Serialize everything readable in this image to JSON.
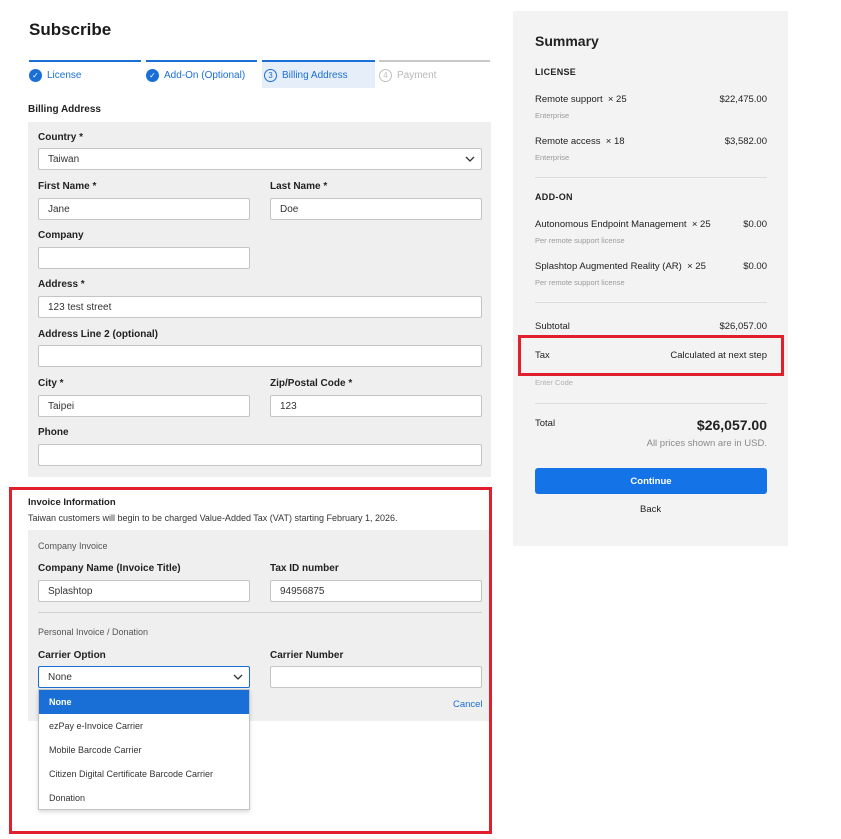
{
  "page": {
    "title": "Subscribe"
  },
  "steps": [
    {
      "label": "License",
      "icon": "check-icon"
    },
    {
      "label": "Add-On (Optional)",
      "icon": "check-icon"
    },
    {
      "number": "3",
      "label": "Billing Address"
    },
    {
      "number": "4",
      "label": "Payment"
    }
  ],
  "billing": {
    "heading": "Billing Address",
    "country_label": "Country *",
    "country_value": "Taiwan",
    "first_name_label": "First Name *",
    "first_name_value": "Jane",
    "last_name_label": "Last Name *",
    "last_name_value": "Doe",
    "company_label": "Company",
    "company_value": "",
    "address_label": "Address *",
    "address_value": "123 test street",
    "address2_label": "Address Line 2 (optional)",
    "address2_value": "",
    "city_label": "City *",
    "city_value": "Taipei",
    "zip_label": "Zip/Postal Code *",
    "zip_value": "123",
    "phone_label": "Phone",
    "phone_value": ""
  },
  "invoice": {
    "heading": "Invoice Information",
    "notice": "Taiwan customers will begin to be charged Value-Added Tax (VAT) starting February 1, 2026.",
    "company_invoice_label": "Company Invoice",
    "company_name_label": "Company Name (Invoice Title)",
    "company_name_value": "Splashtop",
    "tax_id_label": "Tax ID number",
    "tax_id_value": "94956875",
    "personal_label": "Personal Invoice / Donation",
    "carrier_option_label": "Carrier Option",
    "carrier_option_value": "None",
    "carrier_number_label": "Carrier Number",
    "carrier_number_value": "",
    "cancel_label": "Cancel",
    "carrier_options": [
      "None",
      "ezPay e-Invoice Carrier",
      "Mobile Barcode Carrier",
      "Citizen Digital Certificate Barcode Carrier",
      "Donation"
    ]
  },
  "summary": {
    "title": "Summary",
    "license_heading": "LICENSE",
    "license_items": [
      {
        "name": "Remote support",
        "qty": "× 25",
        "price": "$22,475.00",
        "sub": "Enterprise"
      },
      {
        "name": "Remote access",
        "qty": "× 18",
        "price": "$3,582.00",
        "sub": "Enterprise"
      }
    ],
    "addon_heading": "ADD-ON",
    "addon_items": [
      {
        "name": "Autonomous Endpoint Management",
        "qty": "× 25",
        "price": "$0.00",
        "sub": "Per remote support license"
      },
      {
        "name": "Splashtop Augmented Reality (AR)",
        "qty": "× 25",
        "price": "$0.00",
        "sub": "Per remote support license"
      }
    ],
    "subtotal_label": "Subtotal",
    "subtotal_value": "$26,057.00",
    "tax_label": "Tax",
    "tax_value": "Calculated at next step",
    "enter_code": "Enter Code",
    "total_label": "Total",
    "total_value": "$26,057.00",
    "currency_note": "All prices shown are in USD.",
    "continue_label": "Continue",
    "back_label": "Back"
  },
  "colors": {
    "accent": "#1a6fd6",
    "highlight": "#e0202c",
    "panel": "#efefef"
  }
}
